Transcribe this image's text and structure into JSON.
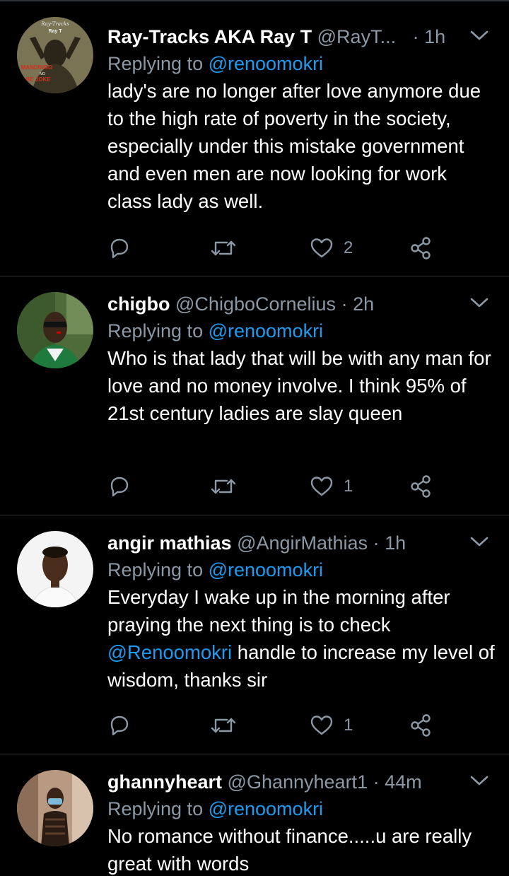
{
  "reply_prefix": "Replying to ",
  "tweets": [
    {
      "name": "Ray-Tracks AKA Ray T",
      "handle": "@RayT...",
      "dot": "·",
      "time": "1h",
      "reply_to": "@renoomokri",
      "text_parts": [
        {
          "text": "lady's are no longer after love anymore due to the high rate of poverty in the society, especially under this mistake government and even men are now looking for work class lady as well.",
          "mention": false
        }
      ],
      "likes": "2",
      "avatar_text": [
        "Ray-Tracks",
        "Ray T",
        "MANDINGO",
        "NO",
        "BE JOKE"
      ]
    },
    {
      "name": "chigbo",
      "handle": "@ChigboCornelius",
      "dot": "·",
      "time": "2h",
      "reply_to": "@renoomokri",
      "text_parts": [
        {
          "text": "Who is that lady that will be with any man for love and no money involve. I think 95% of 21st century ladies are slay queen",
          "mention": false
        }
      ],
      "likes": "1"
    },
    {
      "name": "angir mathias",
      "handle": "@AngirMathias",
      "dot": "·",
      "time": "1h",
      "reply_to": "@renoomokri",
      "text_parts": [
        {
          "text": "Everyday I wake up in the morning after praying the next thing is to check ",
          "mention": false
        },
        {
          "text": "@Renoomokri",
          "mention": true
        },
        {
          "text": " handle to increase my level of wisdom, thanks sir",
          "mention": false
        }
      ],
      "likes": "1"
    },
    {
      "name": "ghannyheart",
      "handle": "@Ghannyheart1",
      "dot": "·",
      "time": "44m",
      "reply_to": "@renoomokri",
      "text_parts": [
        {
          "text": "No romance without finance.....u are really great with words",
          "mention": false
        }
      ],
      "likes": ""
    }
  ],
  "icons": {
    "reply": "reply-icon",
    "retweet": "retweet-icon",
    "like": "heart-icon",
    "share": "share-icon",
    "more": "chevron-down-icon"
  },
  "colors": {
    "background": "#000000",
    "text": "#ffffff",
    "muted": "#8b98a5",
    "link": "#1d9bf0",
    "divider": "#2f3336"
  }
}
